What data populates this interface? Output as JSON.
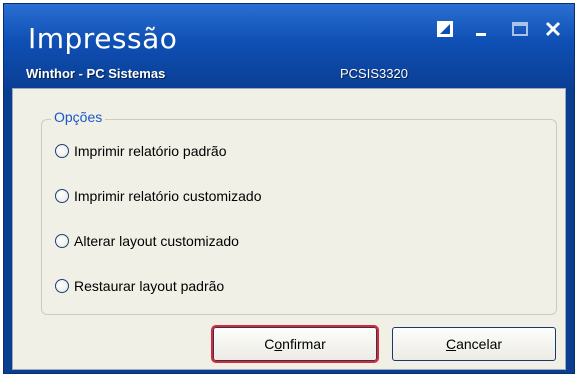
{
  "window": {
    "title": "Impressão",
    "subtitle": "Winthor - PC Sistemas",
    "code": "PCSIS3320",
    "controls": {
      "resize_icon": "resize-icon",
      "minimize_icon": "minimize-icon",
      "maximize_icon": "maximize-icon",
      "close_icon": "close-icon"
    }
  },
  "options": {
    "group_label": "Opções",
    "items": [
      {
        "label": "Imprimir relatório padrão",
        "selected": false
      },
      {
        "label": "Imprimir relatório customizado",
        "selected": false
      },
      {
        "label": "Alterar layout customizado",
        "selected": false
      },
      {
        "label": "Restaurar layout padrão",
        "selected": false
      }
    ]
  },
  "buttons": {
    "confirm": {
      "mnemonic": "o",
      "pre": "C",
      "post": "nfirmar"
    },
    "cancel": {
      "mnemonic": "C",
      "pre": "",
      "post": "ancelar"
    }
  },
  "colors": {
    "titlebar": "#0f4fb4",
    "client": "#f1f0e6",
    "group_label": "#1a57c9",
    "highlight": "#e5232a"
  }
}
